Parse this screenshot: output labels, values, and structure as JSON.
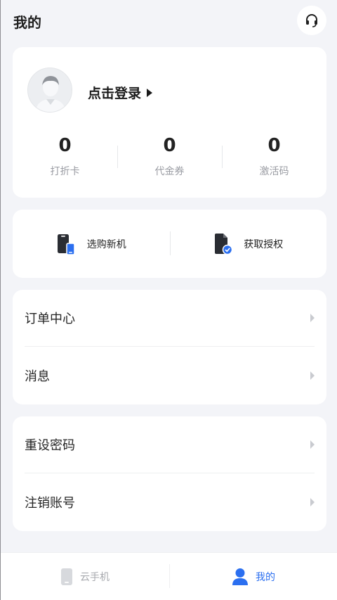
{
  "header": {
    "title": "我的",
    "service_icon": "headset-icon"
  },
  "profile": {
    "login_text": "点击登录",
    "stats": [
      {
        "value": "0",
        "label": "打折卡"
      },
      {
        "value": "0",
        "label": "代金券"
      },
      {
        "value": "0",
        "label": "激活码"
      }
    ]
  },
  "actions": [
    {
      "label": "选购新机",
      "icon": "phone-buy-icon"
    },
    {
      "label": "获取授权",
      "icon": "document-authorize-icon"
    }
  ],
  "menu_group_1": [
    {
      "label": "订单中心"
    },
    {
      "label": "消息"
    }
  ],
  "menu_group_2": [
    {
      "label": "重设密码"
    },
    {
      "label": "注销账号"
    }
  ],
  "tabbar": {
    "tabs": [
      {
        "label": "云手机",
        "active": false
      },
      {
        "label": "我的",
        "active": true
      }
    ]
  },
  "colors": {
    "accent": "#2b6ff0",
    "background": "#f3f4f8"
  }
}
